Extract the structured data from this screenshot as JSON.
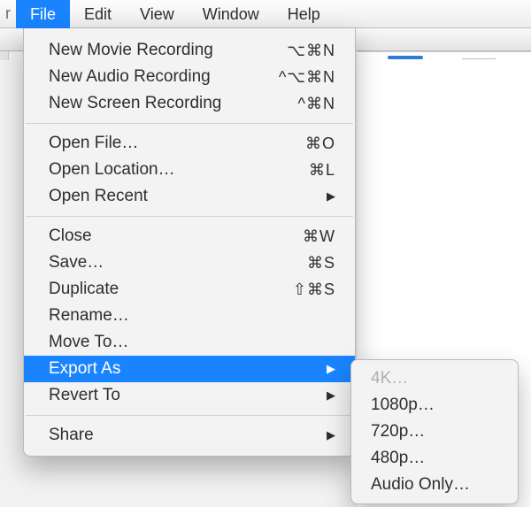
{
  "menubar": {
    "items": [
      {
        "label": "File",
        "selected": true
      },
      {
        "label": "Edit",
        "selected": false
      },
      {
        "label": "View",
        "selected": false
      },
      {
        "label": "Window",
        "selected": false
      },
      {
        "label": "Help",
        "selected": false
      }
    ]
  },
  "file_menu": {
    "groups": [
      [
        {
          "label": "New Movie Recording",
          "shortcut": "⌥⌘N",
          "submenu": false
        },
        {
          "label": "New Audio Recording",
          "shortcut": "^⌥⌘N",
          "submenu": false
        },
        {
          "label": "New Screen Recording",
          "shortcut": "^⌘N",
          "submenu": false
        }
      ],
      [
        {
          "label": "Open File…",
          "shortcut": "⌘O",
          "submenu": false
        },
        {
          "label": "Open Location…",
          "shortcut": "⌘L",
          "submenu": false
        },
        {
          "label": "Open Recent",
          "shortcut": "",
          "submenu": true
        }
      ],
      [
        {
          "label": "Close",
          "shortcut": "⌘W",
          "submenu": false
        },
        {
          "label": "Save…",
          "shortcut": "⌘S",
          "submenu": false
        },
        {
          "label": "Duplicate",
          "shortcut": "⇧⌘S",
          "submenu": false
        },
        {
          "label": "Rename…",
          "shortcut": "",
          "submenu": false
        },
        {
          "label": "Move To…",
          "shortcut": "",
          "submenu": false
        },
        {
          "label": "Export As",
          "shortcut": "",
          "submenu": true,
          "highlight": true
        },
        {
          "label": "Revert To",
          "shortcut": "",
          "submenu": true
        }
      ],
      [
        {
          "label": "Share",
          "shortcut": "",
          "submenu": true
        }
      ]
    ]
  },
  "export_as_submenu": {
    "items": [
      {
        "label": "4K…",
        "disabled": true
      },
      {
        "label": "1080p…",
        "disabled": false
      },
      {
        "label": "720p…",
        "disabled": false
      },
      {
        "label": "480p…",
        "disabled": false
      },
      {
        "label": "Audio Only…",
        "disabled": false
      }
    ]
  }
}
